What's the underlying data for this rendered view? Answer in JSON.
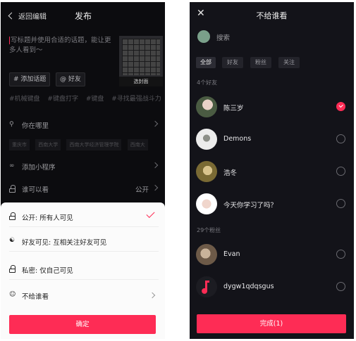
{
  "left": {
    "back_label": "返回编辑",
    "title": "发布",
    "caption_placeholder": "写标题并使用合适的话题，能让更多人看到～",
    "cover_label": "选封面",
    "chips": [
      "# 添加话题",
      "@ 好友"
    ],
    "suggested_tags": [
      "#机械键盘",
      "#键盘打字",
      "#键盘",
      "#寻找最强战斗力"
    ],
    "location_label": "你在哪里",
    "location_tags": [
      "重庆市",
      "西南大学",
      "西南大学经济管理学院",
      "西南大"
    ],
    "mini_program_label": "添加小程序",
    "who_can_see_label": "谁可以看",
    "who_can_see_value": "公开",
    "sheet": {
      "options": [
        {
          "label": "公开: 所有人可见",
          "selected": true
        },
        {
          "label": "好友可见: 互相关注好友可见",
          "selected": false
        },
        {
          "label": "私密: 仅自己可见",
          "selected": false
        },
        {
          "label": "不给谁看",
          "selected": false
        }
      ],
      "confirm_label": "确定"
    }
  },
  "right": {
    "title": "不给谁看",
    "search_placeholder": "搜索",
    "filter_tabs": [
      {
        "label": "全部",
        "active": true
      },
      {
        "label": "好友",
        "active": false
      },
      {
        "label": "粉丝",
        "active": false
      },
      {
        "label": "关注",
        "active": false
      }
    ],
    "friends_header": "4个好友",
    "friends": [
      {
        "name": "陈三岁",
        "checked": true
      },
      {
        "name": "Demons",
        "checked": false
      },
      {
        "name": "浩冬",
        "checked": false
      },
      {
        "name": "今天你学习了吗？",
        "checked": false
      }
    ],
    "fans_header": "29个粉丝",
    "fans": [
      {
        "name": "Evan",
        "checked": false
      },
      {
        "name": "dygw1qdqsgus",
        "checked": false
      }
    ],
    "done_label": "完成(1)"
  },
  "colors": {
    "accent": "#fe2c55",
    "dark_bg": "#131319",
    "sheet_bg": "#fbfbfb"
  }
}
